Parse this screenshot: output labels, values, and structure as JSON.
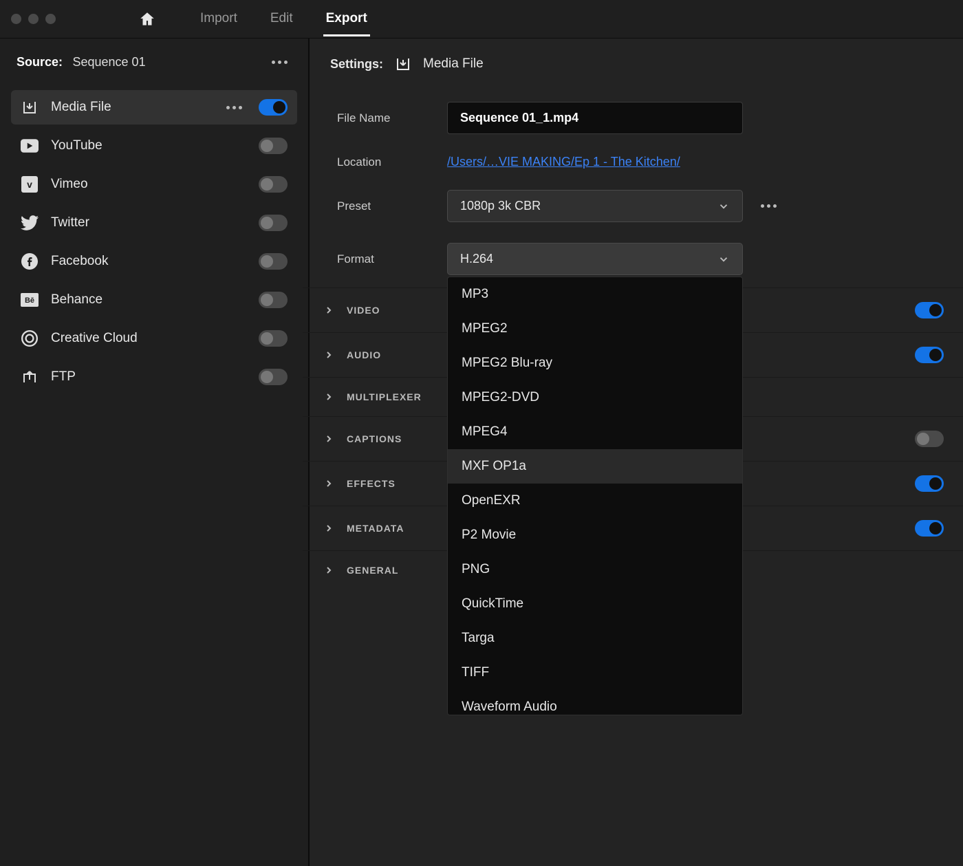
{
  "topbar": {
    "tabs": [
      "Import",
      "Edit",
      "Export"
    ],
    "active_tab": "Export"
  },
  "source": {
    "label": "Source:",
    "value": "Sequence 01"
  },
  "destinations": [
    {
      "id": "media-file",
      "label": "Media File",
      "icon": "download-box",
      "on": true,
      "selected": true
    },
    {
      "id": "youtube",
      "label": "YouTube",
      "icon": "youtube",
      "on": false,
      "selected": false
    },
    {
      "id": "vimeo",
      "label": "Vimeo",
      "icon": "vimeo",
      "on": false,
      "selected": false
    },
    {
      "id": "twitter",
      "label": "Twitter",
      "icon": "twitter",
      "on": false,
      "selected": false
    },
    {
      "id": "facebook",
      "label": "Facebook",
      "icon": "facebook",
      "on": false,
      "selected": false
    },
    {
      "id": "behance",
      "label": "Behance",
      "icon": "behance",
      "on": false,
      "selected": false
    },
    {
      "id": "creative-cloud",
      "label": "Creative Cloud",
      "icon": "cc",
      "on": false,
      "selected": false
    },
    {
      "id": "ftp",
      "label": "FTP",
      "icon": "upload",
      "on": false,
      "selected": false
    }
  ],
  "settings": {
    "label": "Settings:",
    "destination_title": "Media File",
    "file_name_label": "File Name",
    "file_name_value": "Sequence 01_1.mp4",
    "location_label": "Location",
    "location_value": "/Users/…VIE MAKING/Ep 1 - The Kitchen/",
    "preset_label": "Preset",
    "preset_value": "1080p 3k CBR",
    "format_label": "Format",
    "format_value": "H.264"
  },
  "format_options": [
    "MP3",
    "MPEG2",
    "MPEG2 Blu-ray",
    "MPEG2-DVD",
    "MPEG4",
    "MXF OP1a",
    "OpenEXR",
    "P2 Movie",
    "PNG",
    "QuickTime",
    "Targa",
    "TIFF",
    "Waveform Audio"
  ],
  "format_hover_index": 5,
  "accordions": [
    {
      "label": "VIDEO",
      "toggle": true
    },
    {
      "label": "AUDIO",
      "toggle": true
    },
    {
      "label": "MULTIPLEXER",
      "toggle": null
    },
    {
      "label": "CAPTIONS",
      "toggle": false
    },
    {
      "label": "EFFECTS",
      "toggle": true
    },
    {
      "label": "METADATA",
      "toggle": true
    },
    {
      "label": "GENERAL",
      "toggle": null
    }
  ]
}
